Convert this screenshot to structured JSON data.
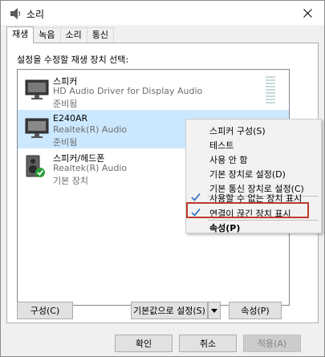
{
  "window": {
    "title": "소리",
    "colors": {
      "selection": "#cce8ff",
      "check": "#3a78c8",
      "annotation": "#c0392b",
      "accent": "#0078d7"
    }
  },
  "tabs": [
    {
      "label": "재생"
    },
    {
      "label": "녹음"
    },
    {
      "label": "소리"
    },
    {
      "label": "통신"
    }
  ],
  "instruction": "설정을 수정할 재생 장치 선택:",
  "devices": [
    {
      "name": "스피커",
      "driver": "HD Audio Driver for Display Audio",
      "status": "준비됨",
      "icon": "monitor-speaker-icon"
    },
    {
      "name": "E240AR",
      "driver": "Realtek(R) Audio",
      "status": "준비됨",
      "icon": "monitor-icon"
    },
    {
      "name": "스피커/헤드폰",
      "driver": "Realtek(R) Audio",
      "status": "기본 장치",
      "icon": "speaker-default-icon"
    }
  ],
  "context_menu": {
    "items": [
      {
        "label": "스피커 구성(S)",
        "checked": false
      },
      {
        "label": "테스트",
        "checked": false
      },
      {
        "label": "사용 안 함",
        "checked": false
      },
      {
        "label": "기본 장치로 설정(D)",
        "checked": false
      },
      {
        "label": "기본 통신 장치로 설정(C)",
        "checked": false
      },
      {
        "label": "사용할 수 없는 장치 표시",
        "checked": true
      },
      {
        "label": "연결이 끊긴 장치 표시",
        "checked": true
      },
      {
        "label": "속성(P)",
        "checked": false,
        "bold": true
      }
    ]
  },
  "buttons": {
    "configure": "구성(C)",
    "set_default": "기본값으로 설정(S)",
    "properties": "속성(P)",
    "ok": "확인",
    "cancel": "취소",
    "apply": "적용(A)"
  }
}
